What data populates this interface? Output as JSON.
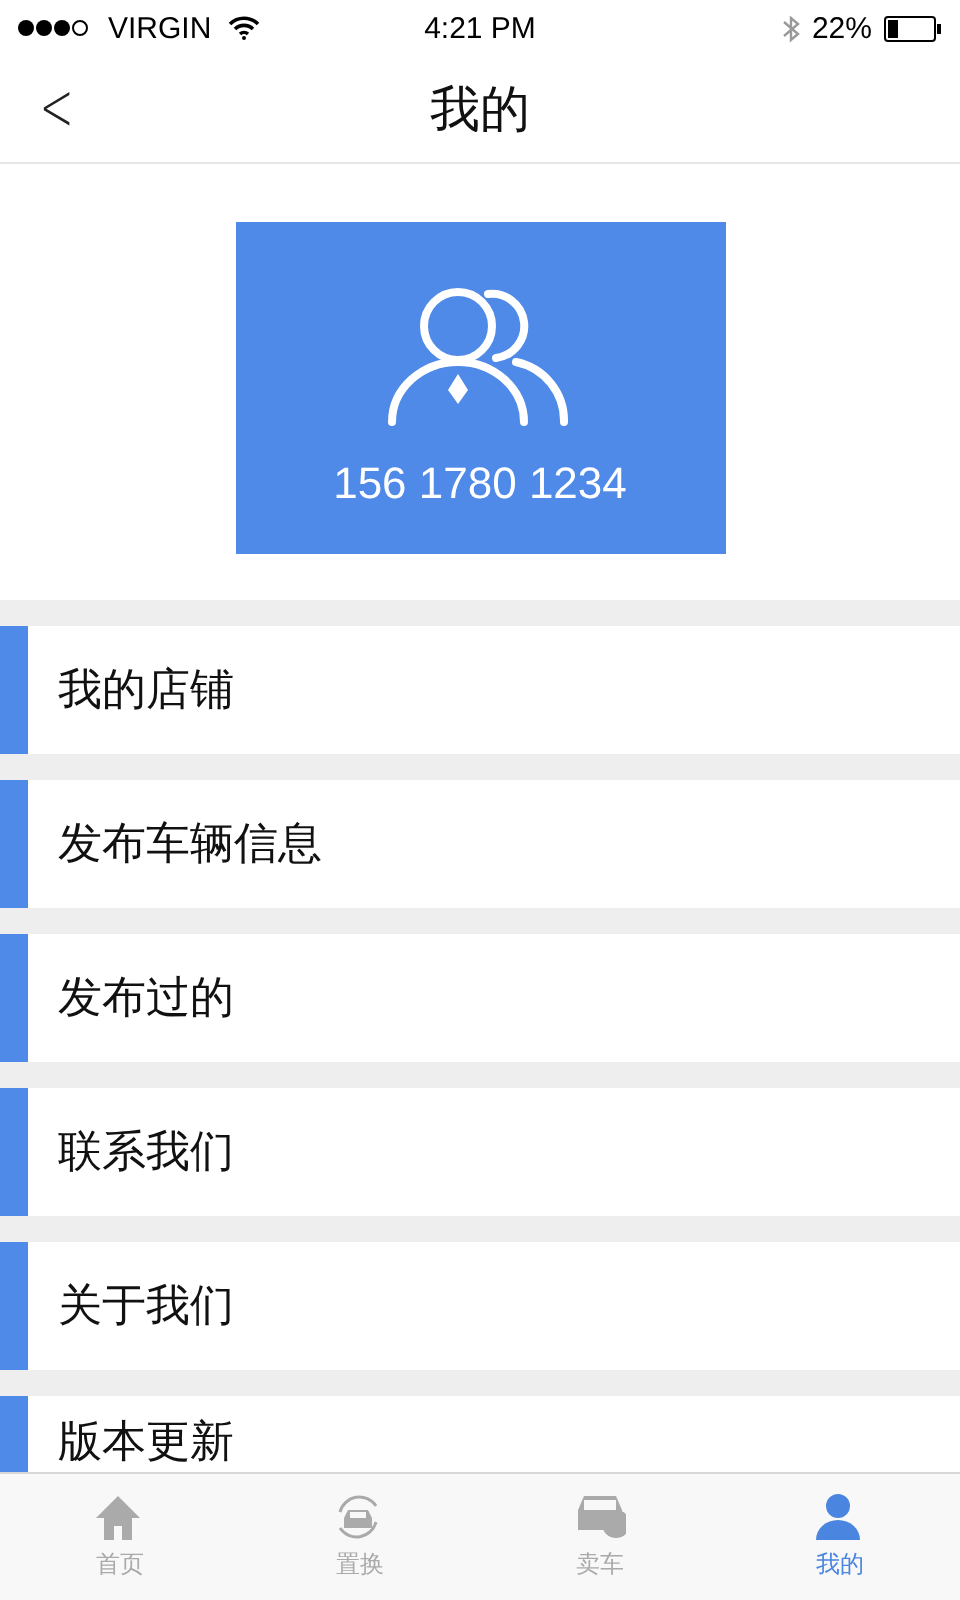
{
  "status_bar": {
    "carrier": "VIRGIN",
    "time": "4:21 PM",
    "battery": "22%"
  },
  "nav": {
    "back": "<",
    "title": "我的"
  },
  "profile": {
    "phone": "156 1780 1234"
  },
  "menu": [
    {
      "label": "我的店铺"
    },
    {
      "label": "发布车辆信息"
    },
    {
      "label": "发布过的"
    },
    {
      "label": "联系我们"
    },
    {
      "label": "关于我们"
    },
    {
      "label": "版本更新"
    }
  ],
  "tabs": [
    {
      "kind": "home",
      "label": "首页",
      "selected": false
    },
    {
      "kind": "swap",
      "label": "置换",
      "selected": false
    },
    {
      "kind": "sell",
      "label": "卖车",
      "selected": false
    },
    {
      "kind": "me",
      "label": "我的",
      "selected": true
    }
  ]
}
